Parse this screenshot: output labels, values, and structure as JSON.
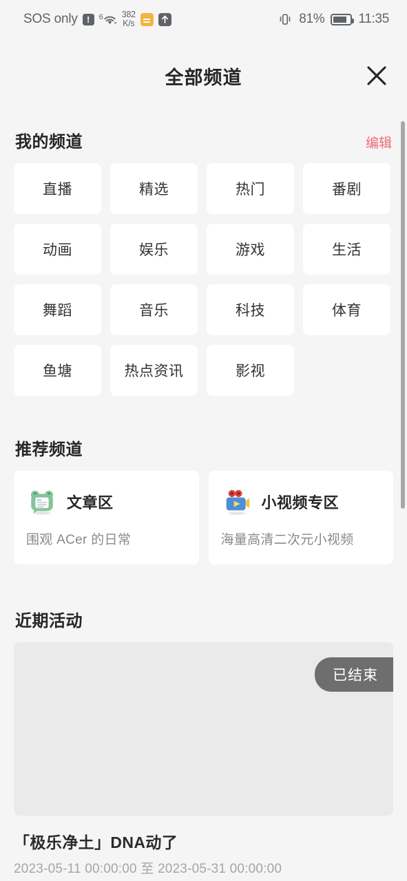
{
  "statusbar": {
    "carrier": "SOS only",
    "alert_icon": "!",
    "wifi_gen": "6",
    "wifi_icon": "wifi-icon",
    "netspeed_value": "382",
    "netspeed_unit": "K/s",
    "orange_icon": "sim-card-icon",
    "upload_icon": "upload-arrow-icon",
    "vibrate_icon": "vibrate-icon",
    "battery_percent": "81%",
    "battery_level": 81,
    "battery_icon": "battery-icon",
    "time": "11:35"
  },
  "header": {
    "title": "全部频道",
    "close_icon": "close-icon"
  },
  "my_channels": {
    "title": "我的频道",
    "action_label": "编辑",
    "tiles": [
      "直播",
      "精选",
      "热门",
      "番剧",
      "动画",
      "娱乐",
      "游戏",
      "生活",
      "舞蹈",
      "音乐",
      "科技",
      "体育",
      "鱼塘",
      "热点资讯",
      "影视"
    ]
  },
  "recommended_channels": {
    "title": "推荐频道",
    "cards": [
      {
        "icon": "frog-article-icon",
        "name": "文章区",
        "desc": "围观 ACer 的日常"
      },
      {
        "icon": "video-camera-icon",
        "name": "小视频专区",
        "desc": "海量高清二次元小视频"
      }
    ]
  },
  "activities": {
    "title": "近期活动",
    "items": [
      {
        "badge": "已结束",
        "title": "「极乐净土」DNA动了",
        "date_range": "2023-05-11 00:00:00 至 2023-05-31 00:00:00"
      }
    ]
  },
  "colors": {
    "page_bg": "#f5f5f5",
    "tile_bg": "#ffffff",
    "accent_pink": "#ef6a7b",
    "badge_gray": "#6e6e6e",
    "banner_gray": "#eaeaea",
    "status_orange": "#f3b53f"
  }
}
